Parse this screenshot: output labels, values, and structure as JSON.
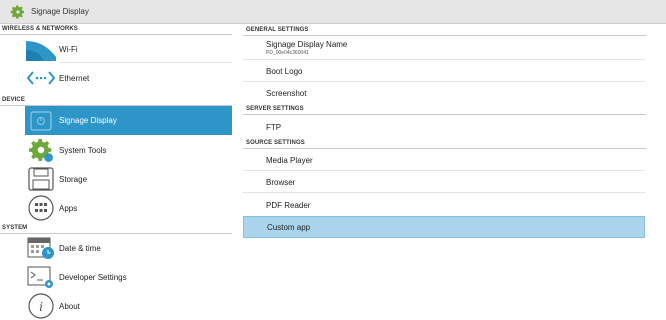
{
  "window": {
    "title": "Signage Display",
    "icon": "gear-icon"
  },
  "left": {
    "sections": [
      {
        "header": "WIRELESS & NETWORKS"
      },
      {
        "header": "DEVICE"
      },
      {
        "header": "SYSTEM"
      }
    ],
    "items": [
      {
        "label": "Wi-Fi",
        "icon": "wifi-icon"
      },
      {
        "label": "Ethernet",
        "icon": "ethernet-icon"
      },
      {
        "label": "Signage Display",
        "icon": "signage-display-icon",
        "selected": true
      },
      {
        "label": "System Tools",
        "icon": "gear-icon"
      },
      {
        "label": "Storage",
        "icon": "storage-icon"
      },
      {
        "label": "Apps",
        "icon": "apps-icon"
      },
      {
        "label": "Date & time",
        "icon": "calendar-clock-icon"
      },
      {
        "label": "Developer Settings",
        "icon": "terminal-icon"
      },
      {
        "label": "About",
        "icon": "info-icon"
      }
    ]
  },
  "right": {
    "sections": [
      {
        "header": "GENERAL SETTINGS"
      },
      {
        "header": "SERVER SETTINGS"
      },
      {
        "header": "SOURCE SETTINGS"
      }
    ],
    "items": [
      {
        "label": "Signage Display Name",
        "value": "PD_00e04c360041"
      },
      {
        "label": "Boot Logo"
      },
      {
        "label": "Screenshot"
      },
      {
        "label": "FTP"
      },
      {
        "label": "Media Player"
      },
      {
        "label": "Browser"
      },
      {
        "label": "PDF Reader"
      },
      {
        "label": "Custom app",
        "selected": true
      }
    ]
  },
  "colors": {
    "accent": "#2d95c8",
    "highlight": "#a9d4ec",
    "titlebar": "#e6e6e6"
  }
}
